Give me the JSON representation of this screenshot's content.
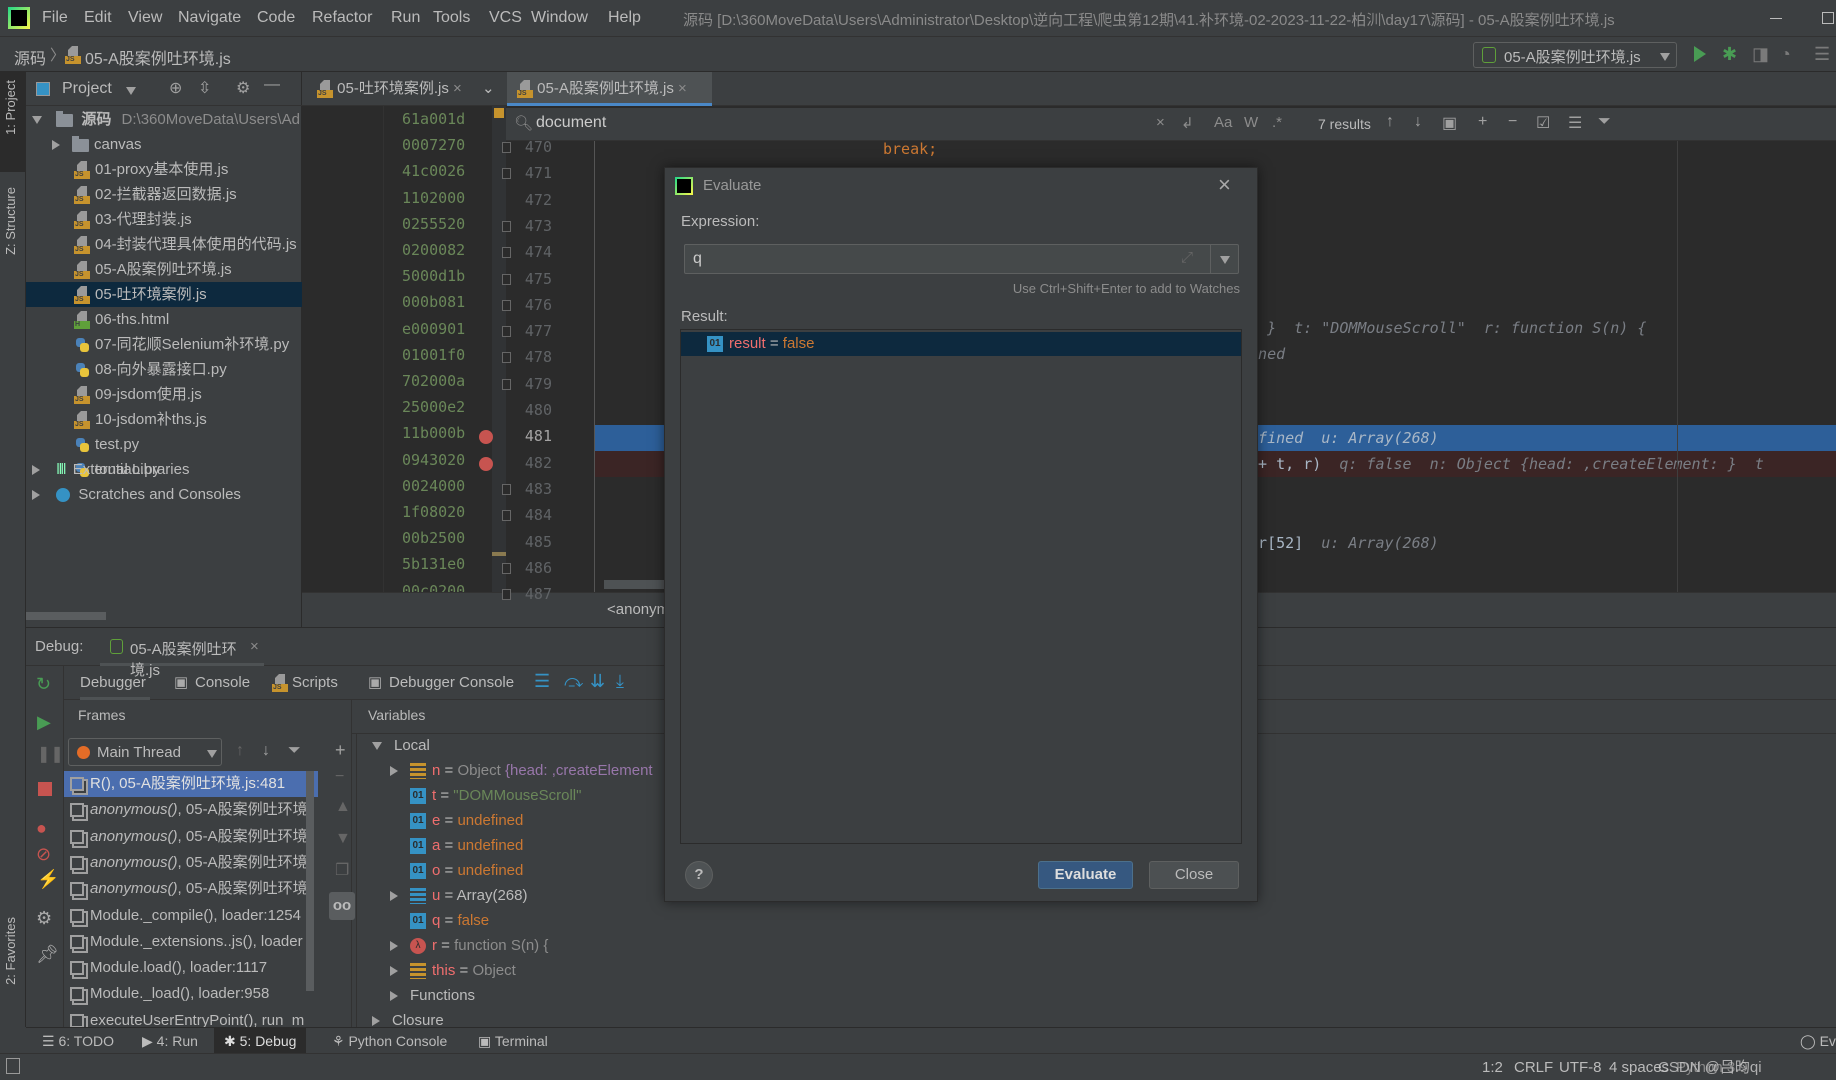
{
  "menu": {
    "items": [
      "File",
      "Edit",
      "View",
      "Navigate",
      "Code",
      "Refactor",
      "Run",
      "Tools",
      "VCS",
      "Window",
      "Help"
    ],
    "window_title": "源码 [D:\\360MoveData\\Users\\Administrator\\Desktop\\逆向工程\\爬虫第12期\\41.补环境-02-2023-11-22-柏汌\\day17\\源码] - 05-A股案例吐环境.js"
  },
  "navbar": {
    "breadcrumb": [
      "源码",
      "05-A股案例吐环境.js"
    ],
    "run_config": "05-A股案例吐环境.js"
  },
  "side_tabs": {
    "project": "1: Project",
    "structure": "Z: Structure",
    "favorites": "2: Favorites"
  },
  "project": {
    "title": "Project",
    "root": {
      "name": "源码",
      "path": "D:\\360MoveData\\Users\\Ad"
    },
    "items": [
      {
        "name": "canvas",
        "type": "folder"
      },
      {
        "name": "01-proxy基本使用.js",
        "type": "js"
      },
      {
        "name": "02-拦截器返回数据.js",
        "type": "js"
      },
      {
        "name": "03-代理封装.js",
        "type": "js"
      },
      {
        "name": "04-封装代理具体使用的代码.js",
        "type": "js"
      },
      {
        "name": "05-A股案例吐环境.js",
        "type": "js"
      },
      {
        "name": "05-吐环境案例.js",
        "type": "js",
        "selected": true
      },
      {
        "name": "06-ths.html",
        "type": "html"
      },
      {
        "name": "07-同花顺Selenium补环境.py",
        "type": "py"
      },
      {
        "name": "08-向外暴露接口.py",
        "type": "py"
      },
      {
        "name": "09-jsdom使用.js",
        "type": "js"
      },
      {
        "name": "10-jsdom补ths.js",
        "type": "js"
      },
      {
        "name": "test.py",
        "type": "py"
      },
      {
        "name": "toutiao.py",
        "type": "py"
      }
    ],
    "external": "External Libraries",
    "scratches": "Scratches and Consoles"
  },
  "editor": {
    "tabs": [
      {
        "label": "05-吐环境案例.js"
      },
      {
        "label": "05-A股案例吐环境.js",
        "active": true
      }
    ],
    "hex_lines": [
      "61a001d",
      "0007270",
      "41c0026",
      "1102000",
      "0255520",
      "0200082",
      "5000d1b",
      "000b081",
      "e000901",
      "01001f0",
      "702000a",
      "25000e2",
      "11b000b",
      "0943020",
      "0024000",
      "1f08020",
      "00b2500",
      "5b131e0",
      "00c0200"
    ],
    "search": {
      "query": "document",
      "results": "7 results"
    },
    "line_numbers": [
      470,
      471,
      472,
      473,
      474,
      475,
      476,
      477,
      478,
      479,
      480,
      481,
      482,
      483,
      484,
      485,
      486,
      487
    ],
    "execution_line": 481,
    "breakpoint_lines": [
      481,
      482
    ],
    "code": {
      "l470": "break;",
      "l479": "t: }  t: \"DOMMouseScroll\"  r: function S(n) {",
      "l480": "fined",
      "l481": "defined  u: Array(268)",
      "l482_code": "] + t, r)",
      "l482_hint": "  q: false  n: Object {head: ,createElement: }  t",
      "l485_code": "> r[52]",
      "l485_hint": "  u: Array(268)"
    },
    "scope_breadcrumb": "<anonym"
  },
  "dialog": {
    "title": "Evaluate",
    "expression_label": "Expression:",
    "expression_value": "q",
    "hint": "Use Ctrl+Shift+Enter to add to Watches",
    "result_label": "Result:",
    "result": {
      "name": "result",
      "value": "false"
    },
    "evaluate_button": "Evaluate",
    "close_button": "Close",
    "help": "?"
  },
  "debug": {
    "label": "Debug:",
    "session": "05-A股案例吐环境.js",
    "tabs": [
      "Debugger",
      "Console",
      "Scripts",
      "Debugger Console"
    ],
    "frames_title": "Frames",
    "variables_title": "Variables",
    "thread": "Main Thread",
    "frames": [
      {
        "fn": "R()",
        "loc": ", 05-A股案例吐环境.js:481",
        "selected": true
      },
      {
        "fn": "anonymous()",
        "loc": ", 05-A股案例吐环境.",
        "italic": true
      },
      {
        "fn": "anonymous()",
        "loc": ", 05-A股案例吐环境.",
        "italic": true
      },
      {
        "fn": "anonymous()",
        "loc": ", 05-A股案例吐环境.",
        "italic": true
      },
      {
        "fn": "anonymous()",
        "loc": ", 05-A股案例吐环境.",
        "italic": true
      },
      {
        "fn": "Module._compile()",
        "loc": ", loader:1254"
      },
      {
        "fn": "Module._extensions..js()",
        "loc": ", loader"
      },
      {
        "fn": "Module.load()",
        "loc": ", loader:1117"
      },
      {
        "fn": "Module._load()",
        "loc": ", loader:958"
      },
      {
        "fn": "executeUserEntryPoint()",
        "loc": ", run_m"
      }
    ],
    "variables": {
      "local": "Local",
      "items": [
        {
          "name": "n",
          "kind": "obj",
          "expand": true,
          "value": "Object ",
          "extra": "{head: ,createElement",
          "vclass": "grey"
        },
        {
          "name": "t",
          "kind": "prim",
          "value": "\"DOMMouseScroll\"",
          "vclass": "str"
        },
        {
          "name": "e",
          "kind": "prim",
          "value": "undefined",
          "vclass": "undef"
        },
        {
          "name": "a",
          "kind": "prim",
          "value": "undefined",
          "vclass": "undef"
        },
        {
          "name": "o",
          "kind": "prim",
          "value": "undefined",
          "vclass": "undef"
        },
        {
          "name": "u",
          "kind": "arr",
          "expand": true,
          "value": "Array(268)",
          "vclass": ""
        },
        {
          "name": "q",
          "kind": "prim",
          "value": "false",
          "vclass": "undef"
        },
        {
          "name": "r",
          "kind": "fn",
          "expand": true,
          "value": "function S(n) {",
          "vclass": "grey"
        },
        {
          "name": "this",
          "kind": "obj",
          "expand": true,
          "value": "Object",
          "vclass": "grey"
        }
      ],
      "functions": "Functions",
      "closure": "Closure"
    }
  },
  "bottom_tools": [
    "6: TODO",
    "4: Run",
    "5: Debug",
    "Python Console",
    "Terminal"
  ],
  "event_log": "Eve",
  "status": {
    "position": "1:2",
    "line_sep": "CRLF",
    "encoding": "UTF-8",
    "indent": "4 spaces",
    "interpreter": "Python 3.9"
  },
  "watermark": "CSDN @吕昀qi",
  "colors": {
    "accent": "#4b6eaf",
    "selection": "#0d293e",
    "exec_line": "#2d5f99",
    "breakpoint_line": "#3b2525",
    "keyword": "#cc7832",
    "string": "#6a8759"
  }
}
